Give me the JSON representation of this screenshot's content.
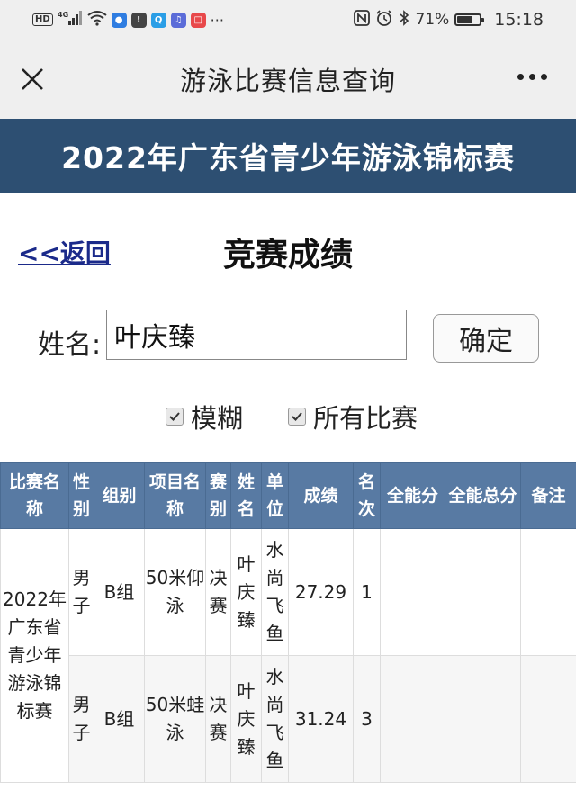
{
  "status_bar": {
    "hd": "HD",
    "network": "4G",
    "battery_text": "71%",
    "battery_level": 0.71,
    "time": "15:18"
  },
  "nav": {
    "title": "游泳比赛信息查询",
    "close_icon": "close-icon",
    "more_icon": "more-dots-icon"
  },
  "banner": {
    "text": "2022年广东省青少年游泳锦标赛"
  },
  "page": {
    "back_label": "<<返回",
    "section_title": "竞赛成绩"
  },
  "search": {
    "name_label": "姓名:",
    "name_value": "叶庆臻",
    "confirm_label": "确定"
  },
  "filters": {
    "fuzzy_label": "模糊",
    "fuzzy_checked": true,
    "all_label": "所有比赛",
    "all_checked": true
  },
  "table": {
    "headers": [
      "比赛名称",
      "性别",
      "组别",
      "项目名称",
      "赛别",
      "姓名",
      "单位",
      "成绩",
      "名次",
      "全能分",
      "全能总分",
      "备注"
    ],
    "event_name": "2022年广东省青少年游泳锦标赛",
    "rows": [
      {
        "gender": "男子",
        "group": "B组",
        "item": "50米仰泳",
        "stage": "决赛",
        "name": "叶庆臻",
        "unit": "水尚飞鱼",
        "score": "27.29",
        "rank": "1",
        "all_round": "",
        "all_round_total": "",
        "note": ""
      },
      {
        "gender": "男子",
        "group": "B组",
        "item": "50米蛙泳",
        "stage": "决赛",
        "name": "叶庆臻",
        "unit": "水尚飞鱼",
        "score": "31.24",
        "rank": "3",
        "all_round": "",
        "all_round_total": "",
        "note": ""
      }
    ]
  },
  "colors": {
    "banner_bg": "#2d4f72",
    "table_header_bg": "#587aa3",
    "link": "#1b2a8a"
  }
}
